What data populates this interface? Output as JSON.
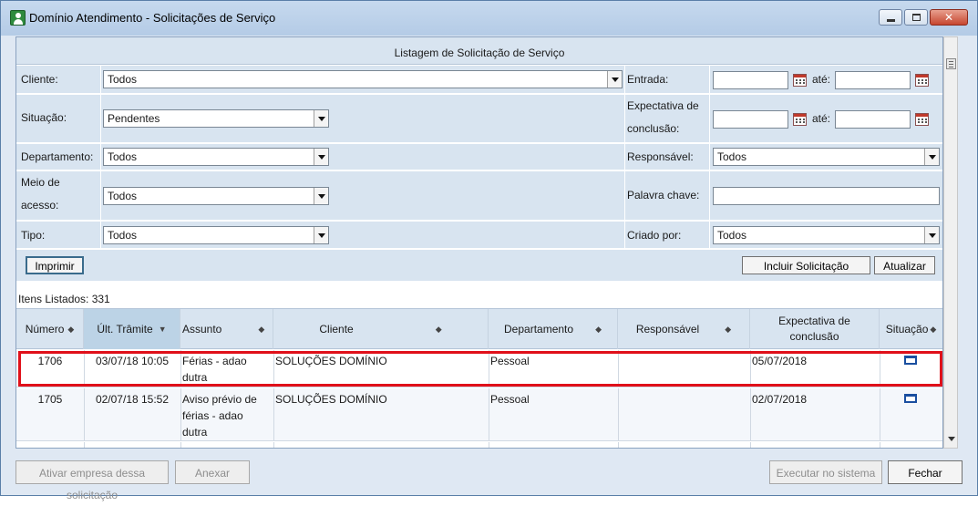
{
  "window": {
    "title": "Domínio Atendimento - Solicitações de Serviço",
    "buttons": {
      "minimize": "minimize",
      "maximize": "maximize",
      "close": "✕"
    }
  },
  "listing": {
    "title": "Listagem de Solicitação de Serviço"
  },
  "filters": {
    "cliente": {
      "label": "Cliente:",
      "value": "Todos"
    },
    "entrada": {
      "label": "Entrada:",
      "from": "",
      "ate": "até:",
      "to": ""
    },
    "situacao": {
      "label": "Situação:",
      "value": "Pendentes"
    },
    "expectativa": {
      "label_line1": "Expectativa de",
      "label_line2": "conclusão:",
      "from": "",
      "ate": "até:",
      "to": ""
    },
    "departamento": {
      "label": "Departamento:",
      "value": "Todos"
    },
    "responsavel": {
      "label": "Responsável:",
      "value": "Todos"
    },
    "meio": {
      "label_line1": "Meio de",
      "label_line2": "acesso:",
      "value": "Todos"
    },
    "palavra": {
      "label": "Palavra chave:",
      "value": ""
    },
    "tipo": {
      "label": "Tipo:",
      "value": "Todos"
    },
    "criado": {
      "label": "Criado por:",
      "value": "Todos"
    }
  },
  "actions": {
    "imprimir": "Imprimir",
    "incluir": "Incluir Solicitação",
    "atualizar": "Atualizar"
  },
  "itens_listados": "Itens Listados: 331",
  "table": {
    "columns": [
      {
        "key": "numero",
        "label": "Número"
      },
      {
        "key": "ult_tramite",
        "label": "Últ. Trâmite"
      },
      {
        "key": "assunto",
        "label": "Assunto"
      },
      {
        "key": "cliente",
        "label": "Cliente"
      },
      {
        "key": "departamento",
        "label": "Departamento"
      },
      {
        "key": "responsavel",
        "label": "Responsável"
      },
      {
        "key": "expectativa",
        "label_line1": "Expectativa de",
        "label_line2": "conclusão"
      },
      {
        "key": "situacao",
        "label": "Situação"
      }
    ],
    "rows": [
      {
        "numero": "1706",
        "ult_tramite": "03/07/18 10:05",
        "assunto_line1": "Férias - adao",
        "assunto_line2": "dutra",
        "cliente": "SOLUÇÕES DOMÍNIO",
        "departamento": "Pessoal",
        "responsavel": "",
        "expectativa": "05/07/2018",
        "situacao_icon": "folder-icon"
      },
      {
        "numero": "1705",
        "ult_tramite": "02/07/18 15:52",
        "assunto_line1": "Aviso prévio de",
        "assunto_line2": "férias - adao",
        "assunto_line3": "dutra",
        "cliente": "SOLUÇÕES DOMÍNIO",
        "departamento": "Pessoal",
        "responsavel": "",
        "expectativa": "02/07/2018",
        "situacao_icon": "folder-icon"
      }
    ]
  },
  "footer": {
    "ativar": "Ativar empresa dessa solicitação",
    "anexar": "Anexar",
    "executar": "Executar no sistema",
    "fechar": "Fechar"
  },
  "colors": {
    "highlight": "#e0101a",
    "header_bg": "#d8e4f0",
    "sorted_col": "#bcd3e6"
  }
}
